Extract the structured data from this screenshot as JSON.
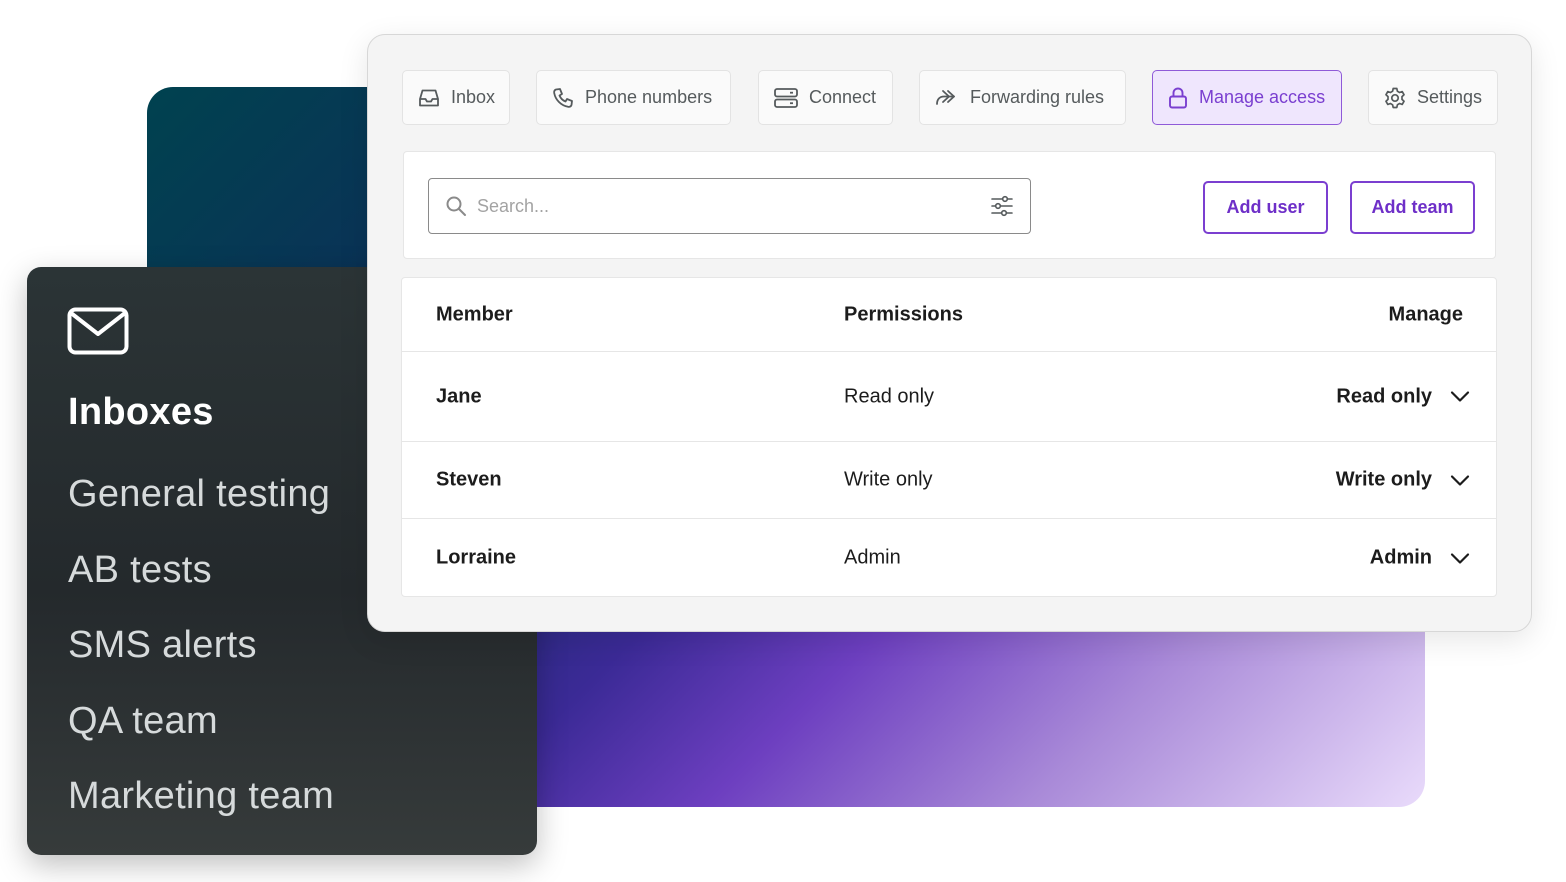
{
  "sidebar": {
    "icon": "mail-icon",
    "title": "Inboxes",
    "items": [
      {
        "label": "General testing"
      },
      {
        "label": "AB tests"
      },
      {
        "label": "SMS alerts"
      },
      {
        "label": "QA team"
      },
      {
        "label": "Marketing team"
      }
    ]
  },
  "tabs": [
    {
      "label": "Inbox",
      "icon": "inbox-tray-icon"
    },
    {
      "label": "Phone numbers",
      "icon": "phone-icon"
    },
    {
      "label": "Connect",
      "icon": "server-icon"
    },
    {
      "label": "Forwarding rules",
      "icon": "forward-arrow-icon"
    },
    {
      "label": "Manage access",
      "icon": "lock-icon",
      "active": true
    },
    {
      "label": "Settings",
      "icon": "gear-icon"
    }
  ],
  "search": {
    "placeholder": "Search...",
    "value": ""
  },
  "actions": {
    "add_user": "Add user",
    "add_team": "Add team"
  },
  "table": {
    "headers": {
      "member": "Member",
      "permissions": "Permissions",
      "manage": "Manage"
    },
    "rows": [
      {
        "member": "Jane",
        "permissions": "Read only",
        "manage": "Read only"
      },
      {
        "member": "Steven",
        "permissions": "Write only",
        "manage": "Write only"
      },
      {
        "member": "Lorraine",
        "permissions": "Admin",
        "manage": "Admin"
      }
    ]
  },
  "colors": {
    "accent": "#7b3fd0",
    "active_tab_bg": "#efe6fd",
    "sidebar_bg": "#24292c"
  }
}
